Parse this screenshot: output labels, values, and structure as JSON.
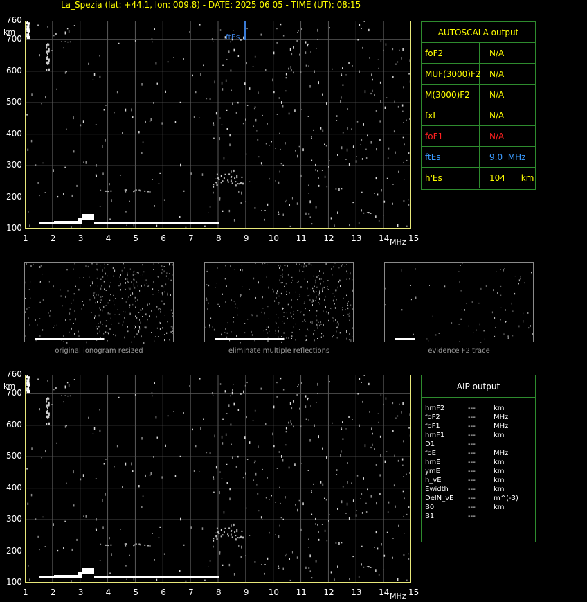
{
  "header": {
    "title": "La_Spezia (lat: +44.1, lon: 009.8) - DATE: 2025 06 05 - TIME (UT): 08:15"
  },
  "ionogram_top": {
    "y_unit": "km",
    "x_unit": "MHz",
    "y_ticks": [
      "760",
      "700",
      "600",
      "500",
      "400",
      "300",
      "200",
      "100"
    ],
    "x_ticks": [
      "1",
      "2",
      "3",
      "4",
      "5",
      "6",
      "7",
      "8",
      "9",
      "10",
      "11",
      "12",
      "13",
      "14",
      "15"
    ],
    "marker_label": "ftEs",
    "marker_color": "#3a7bd5"
  },
  "ionogram_bottom": {
    "y_unit": "km",
    "x_unit": "MHz",
    "y_ticks": [
      "760",
      "700",
      "600",
      "500",
      "400",
      "300",
      "200",
      "100"
    ],
    "x_ticks": [
      "1",
      "2",
      "3",
      "4",
      "5",
      "6",
      "7",
      "8",
      "9",
      "10",
      "11",
      "12",
      "13",
      "14",
      "15"
    ]
  },
  "autoscala": {
    "title": "AUTOSCALA output",
    "rows": [
      {
        "name": "foF2",
        "value": "N/A",
        "color": "#ffff00"
      },
      {
        "name": "MUF(3000)F2",
        "value": "N/A",
        "color": "#ffff00"
      },
      {
        "name": "M(3000)F2",
        "value": "N/A",
        "color": "#ffff00"
      },
      {
        "name": "fxI",
        "value": "N/A",
        "color": "#ffff00"
      },
      {
        "name": "foF1",
        "value": "N/A",
        "color": "#ff2020"
      },
      {
        "name": "ftEs",
        "value": "9.0  MHz",
        "color": "#3a9bff"
      },
      {
        "name": "h'Es",
        "value": "104      km",
        "color": "#ffff00"
      }
    ]
  },
  "thumbnails": [
    {
      "caption": "original ionogram resized"
    },
    {
      "caption": "eliminate multiple reflections"
    },
    {
      "caption": "evidence F2 trace"
    }
  ],
  "aip": {
    "title": "AIP output",
    "rows": [
      {
        "name": "hmF2",
        "value": "---",
        "unit": "km"
      },
      {
        "name": "foF2",
        "value": "---",
        "unit": "MHz"
      },
      {
        "name": "foF1",
        "value": "---",
        "unit": "MHz"
      },
      {
        "name": "hmF1",
        "value": "---",
        "unit": "km"
      },
      {
        "name": "D1",
        "value": "---",
        "unit": ""
      },
      {
        "name": "foE",
        "value": "---",
        "unit": "MHz"
      },
      {
        "name": "hmE",
        "value": "---",
        "unit": "km"
      },
      {
        "name": "ymE",
        "value": "---",
        "unit": "km"
      },
      {
        "name": "h_vE",
        "value": "---",
        "unit": "km"
      },
      {
        "name": "Ewidth",
        "value": "---",
        "unit": "km"
      },
      {
        "name": "DelN_vE",
        "value": "---",
        "unit": "m^(-3)"
      },
      {
        "name": "B0",
        "value": "---",
        "unit": "km"
      },
      {
        "name": "B1",
        "value": "---",
        "unit": ""
      }
    ]
  },
  "colors": {
    "frame": "#e8e87a",
    "grid": "#5a5a5a",
    "panel_border": "#2e8b2e",
    "yellow": "#ffff00"
  }
}
